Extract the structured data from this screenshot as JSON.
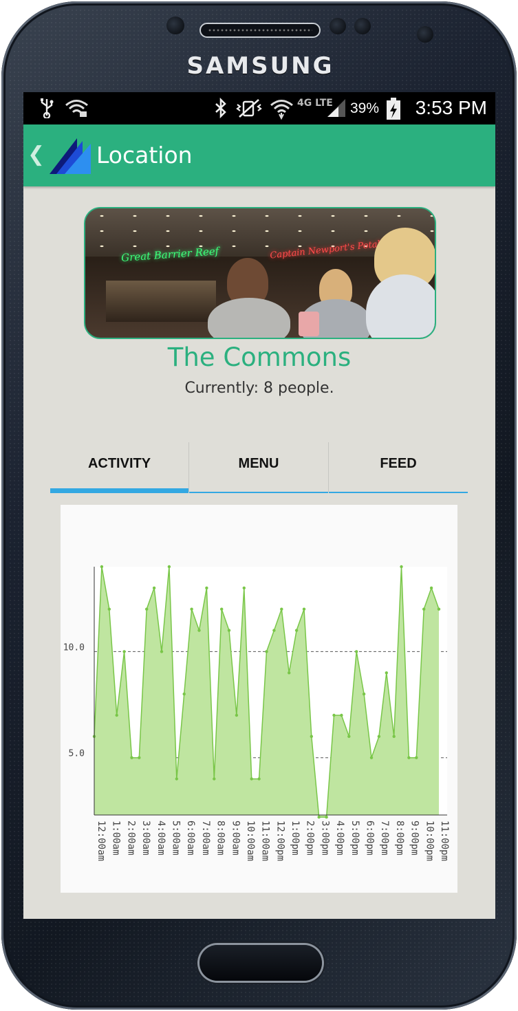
{
  "device": {
    "brand": "SAMSUNG"
  },
  "status_bar": {
    "left_icons": [
      "usb-icon",
      "wifi-icon"
    ],
    "right_icons": [
      "bluetooth-icon",
      "vibrate-icon",
      "wifi-icon",
      "4g-lte-icon",
      "signal-icon",
      "battery-charging-icon"
    ],
    "network_label": "4G LTE",
    "battery": "39%",
    "time": "3:53 PM"
  },
  "action_bar": {
    "title": "Location",
    "background": "#2bb07f",
    "back_icon": "chevron-left-icon",
    "logo_icon": "app-logo-icon"
  },
  "location": {
    "name": "The Commons",
    "count_text": "Currently: 8 people.",
    "photo_signs": [
      "Great Barrier Reef",
      "Captain Newport's Potables"
    ]
  },
  "tabs": [
    {
      "label": "ACTIVITY",
      "active": true
    },
    {
      "label": "MENU",
      "active": false
    },
    {
      "label": "FEED",
      "active": false
    }
  ],
  "accent": "#33a8e2",
  "chart_data": {
    "type": "area",
    "title": "",
    "xlabel": "",
    "ylabel": "",
    "ylim": [
      2.3,
      14.0
    ],
    "yticks": [
      5.0,
      10.0
    ],
    "grid": "horizontal dashed at ticks",
    "fill_color": "#bfe5a0",
    "line_color": "#79c648",
    "x_tick_labels": [
      "12:00am",
      "1:00am",
      "2:00am",
      "3:00am",
      "4:00am",
      "5:00am",
      "6:00am",
      "7:00am",
      "8:00am",
      "9:00am",
      "10:00am",
      "11:00am",
      "12:00pm",
      "1:00pm",
      "2:00pm",
      "3:00pm",
      "4:00pm",
      "5:00pm",
      "6:00pm",
      "7:00pm",
      "8:00pm",
      "9:00pm",
      "10:00pm",
      "11:00pm"
    ],
    "series": [
      {
        "values": [
          6,
          14,
          12,
          7,
          10,
          5,
          5,
          12,
          13,
          10,
          14,
          4,
          8,
          12,
          11,
          13,
          4,
          12,
          11,
          7,
          13,
          4,
          4,
          10,
          11,
          12,
          9,
          11,
          12,
          6,
          2.2,
          2.2,
          7,
          7,
          6,
          10,
          8,
          5,
          6,
          9,
          6,
          14,
          5,
          5,
          12,
          13,
          12
        ]
      }
    ]
  }
}
